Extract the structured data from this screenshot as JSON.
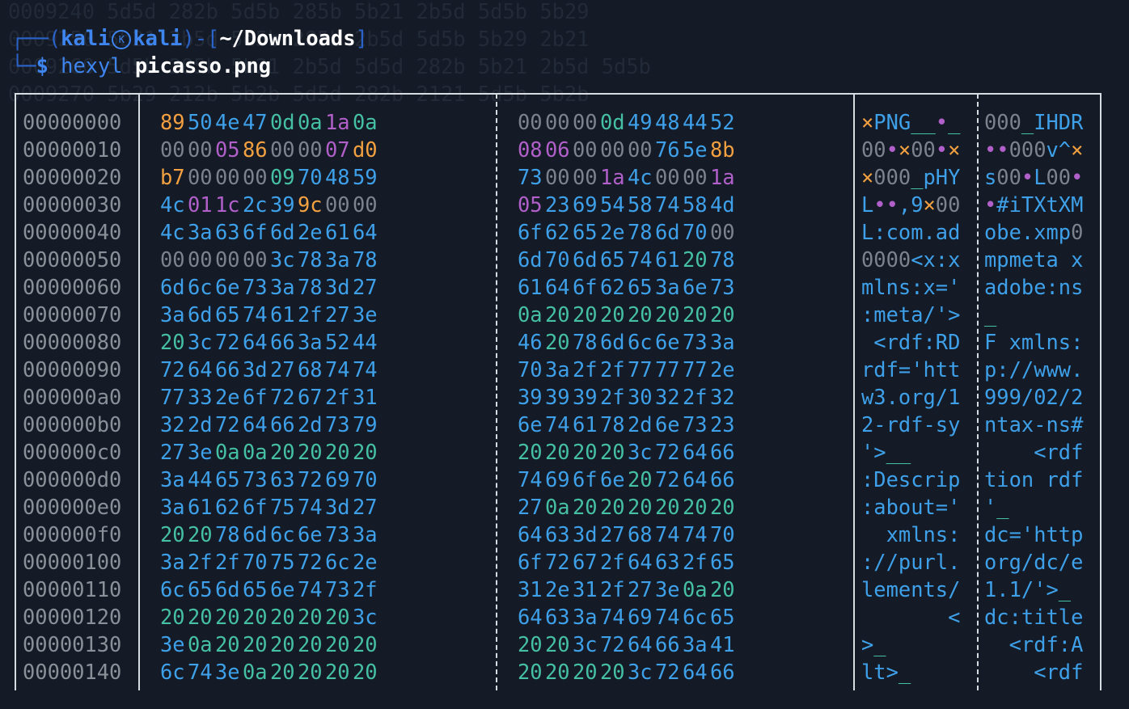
{
  "terminal": {
    "user": "kali",
    "host": "kali",
    "cwd": "~/Downloads",
    "command": "hexyl",
    "argument": "picasso.png",
    "ghost_lines": [
      "0009240 5d5d 282b 5d5b 285b 5b21 2b5d 5d5b 5b29",
      "0009250 5b21 2b5d 5d5b 285b 2b5d 5d5b 5b29 2b21",
      "0009260 5d5b 285b 5b21 2b5d 5d5d 282b 5b21 2b5d 5d5b",
      "0009270 5b29 212b 5b2b 5d5d 282b 2121 5d5b 5b2b"
    ]
  },
  "colors": {
    "null": "#7d838c",
    "printable": "#3ea0e8",
    "whitespace": "#45c0a5",
    "control": "#b15fc9",
    "non_ascii": "#f2a040"
  },
  "hexdump": {
    "rows": [
      {
        "offset": "00000000",
        "bytes": [
          "89",
          "50",
          "4e",
          "47",
          "0d",
          "0a",
          "1a",
          "0a",
          "00",
          "00",
          "00",
          "0d",
          "49",
          "48",
          "44",
          "52"
        ],
        "ascii1": "×PNG__•_",
        "ascii2": "000_IHDR"
      },
      {
        "offset": "00000010",
        "bytes": [
          "00",
          "00",
          "05",
          "86",
          "00",
          "00",
          "07",
          "d0",
          "08",
          "06",
          "00",
          "00",
          "00",
          "76",
          "5e",
          "8b"
        ],
        "ascii1": "00•×00•×",
        "ascii2": "••000v^×"
      },
      {
        "offset": "00000020",
        "bytes": [
          "b7",
          "00",
          "00",
          "00",
          "09",
          "70",
          "48",
          "59",
          "73",
          "00",
          "00",
          "1a",
          "4c",
          "00",
          "00",
          "1a"
        ],
        "ascii1": "×000_pHY",
        "ascii2": "s00•L00•"
      },
      {
        "offset": "00000030",
        "bytes": [
          "4c",
          "01",
          "1c",
          "2c",
          "39",
          "9c",
          "00",
          "00",
          "05",
          "23",
          "69",
          "54",
          "58",
          "74",
          "58",
          "4d"
        ],
        "ascii1": "L••,9×00",
        "ascii2": "•#iTXtXM"
      },
      {
        "offset": "00000040",
        "bytes": [
          "4c",
          "3a",
          "63",
          "6f",
          "6d",
          "2e",
          "61",
          "64",
          "6f",
          "62",
          "65",
          "2e",
          "78",
          "6d",
          "70",
          "00"
        ],
        "ascii1": "L:com.ad",
        "ascii2": "obe.xmp0"
      },
      {
        "offset": "00000050",
        "bytes": [
          "00",
          "00",
          "00",
          "00",
          "3c",
          "78",
          "3a",
          "78",
          "6d",
          "70",
          "6d",
          "65",
          "74",
          "61",
          "20",
          "78"
        ],
        "ascii1": "0000<x:x",
        "ascii2": "mpmeta x"
      },
      {
        "offset": "00000060",
        "bytes": [
          "6d",
          "6c",
          "6e",
          "73",
          "3a",
          "78",
          "3d",
          "27",
          "61",
          "64",
          "6f",
          "62",
          "65",
          "3a",
          "6e",
          "73"
        ],
        "ascii1": "mlns:x='",
        "ascii2": "adobe:ns"
      },
      {
        "offset": "00000070",
        "bytes": [
          "3a",
          "6d",
          "65",
          "74",
          "61",
          "2f",
          "27",
          "3e",
          "0a",
          "20",
          "20",
          "20",
          "20",
          "20",
          "20",
          "20"
        ],
        "ascii1": ":meta/'>",
        "ascii2": "_       "
      },
      {
        "offset": "00000080",
        "bytes": [
          "20",
          "3c",
          "72",
          "64",
          "66",
          "3a",
          "52",
          "44",
          "46",
          "20",
          "78",
          "6d",
          "6c",
          "6e",
          "73",
          "3a"
        ],
        "ascii1": " <rdf:RD",
        "ascii2": "F xmlns:"
      },
      {
        "offset": "00000090",
        "bytes": [
          "72",
          "64",
          "66",
          "3d",
          "27",
          "68",
          "74",
          "74",
          "70",
          "3a",
          "2f",
          "2f",
          "77",
          "77",
          "77",
          "2e"
        ],
        "ascii1": "rdf='htt",
        "ascii2": "p://www."
      },
      {
        "offset": "000000a0",
        "bytes": [
          "77",
          "33",
          "2e",
          "6f",
          "72",
          "67",
          "2f",
          "31",
          "39",
          "39",
          "39",
          "2f",
          "30",
          "32",
          "2f",
          "32"
        ],
        "ascii1": "w3.org/1",
        "ascii2": "999/02/2"
      },
      {
        "offset": "000000b0",
        "bytes": [
          "32",
          "2d",
          "72",
          "64",
          "66",
          "2d",
          "73",
          "79",
          "6e",
          "74",
          "61",
          "78",
          "2d",
          "6e",
          "73",
          "23"
        ],
        "ascii1": "2-rdf-sy",
        "ascii2": "ntax-ns#"
      },
      {
        "offset": "000000c0",
        "bytes": [
          "27",
          "3e",
          "0a",
          "0a",
          "20",
          "20",
          "20",
          "20",
          "20",
          "20",
          "20",
          "20",
          "3c",
          "72",
          "64",
          "66"
        ],
        "ascii1": "'>__    ",
        "ascii2": "    <rdf"
      },
      {
        "offset": "000000d0",
        "bytes": [
          "3a",
          "44",
          "65",
          "73",
          "63",
          "72",
          "69",
          "70",
          "74",
          "69",
          "6f",
          "6e",
          "20",
          "72",
          "64",
          "66"
        ],
        "ascii1": ":Descrip",
        "ascii2": "tion rdf"
      },
      {
        "offset": "000000e0",
        "bytes": [
          "3a",
          "61",
          "62",
          "6f",
          "75",
          "74",
          "3d",
          "27",
          "27",
          "0a",
          "20",
          "20",
          "20",
          "20",
          "20",
          "20"
        ],
        "ascii1": ":about='",
        "ascii2": "'_      "
      },
      {
        "offset": "000000f0",
        "bytes": [
          "20",
          "20",
          "78",
          "6d",
          "6c",
          "6e",
          "73",
          "3a",
          "64",
          "63",
          "3d",
          "27",
          "68",
          "74",
          "74",
          "70"
        ],
        "ascii1": "  xmlns:",
        "ascii2": "dc='http"
      },
      {
        "offset": "00000100",
        "bytes": [
          "3a",
          "2f",
          "2f",
          "70",
          "75",
          "72",
          "6c",
          "2e",
          "6f",
          "72",
          "67",
          "2f",
          "64",
          "63",
          "2f",
          "65"
        ],
        "ascii1": "://purl.",
        "ascii2": "org/dc/e"
      },
      {
        "offset": "00000110",
        "bytes": [
          "6c",
          "65",
          "6d",
          "65",
          "6e",
          "74",
          "73",
          "2f",
          "31",
          "2e",
          "31",
          "2f",
          "27",
          "3e",
          "0a",
          "20"
        ],
        "ascii1": "lements/",
        "ascii2": "1.1/'>_ "
      },
      {
        "offset": "00000120",
        "bytes": [
          "20",
          "20",
          "20",
          "20",
          "20",
          "20",
          "20",
          "3c",
          "64",
          "63",
          "3a",
          "74",
          "69",
          "74",
          "6c",
          "65"
        ],
        "ascii1": "       <",
        "ascii2": "dc:title"
      },
      {
        "offset": "00000130",
        "bytes": [
          "3e",
          "0a",
          "20",
          "20",
          "20",
          "20",
          "20",
          "20",
          "20",
          "20",
          "3c",
          "72",
          "64",
          "66",
          "3a",
          "41"
        ],
        "ascii1": ">_      ",
        "ascii2": "  <rdf:A"
      },
      {
        "offset": "00000140",
        "bytes": [
          "6c",
          "74",
          "3e",
          "0a",
          "20",
          "20",
          "20",
          "20",
          "20",
          "20",
          "20",
          "20",
          "3c",
          "72",
          "64",
          "66"
        ],
        "ascii1": "lt>_    ",
        "ascii2": "    <rdf"
      }
    ]
  }
}
